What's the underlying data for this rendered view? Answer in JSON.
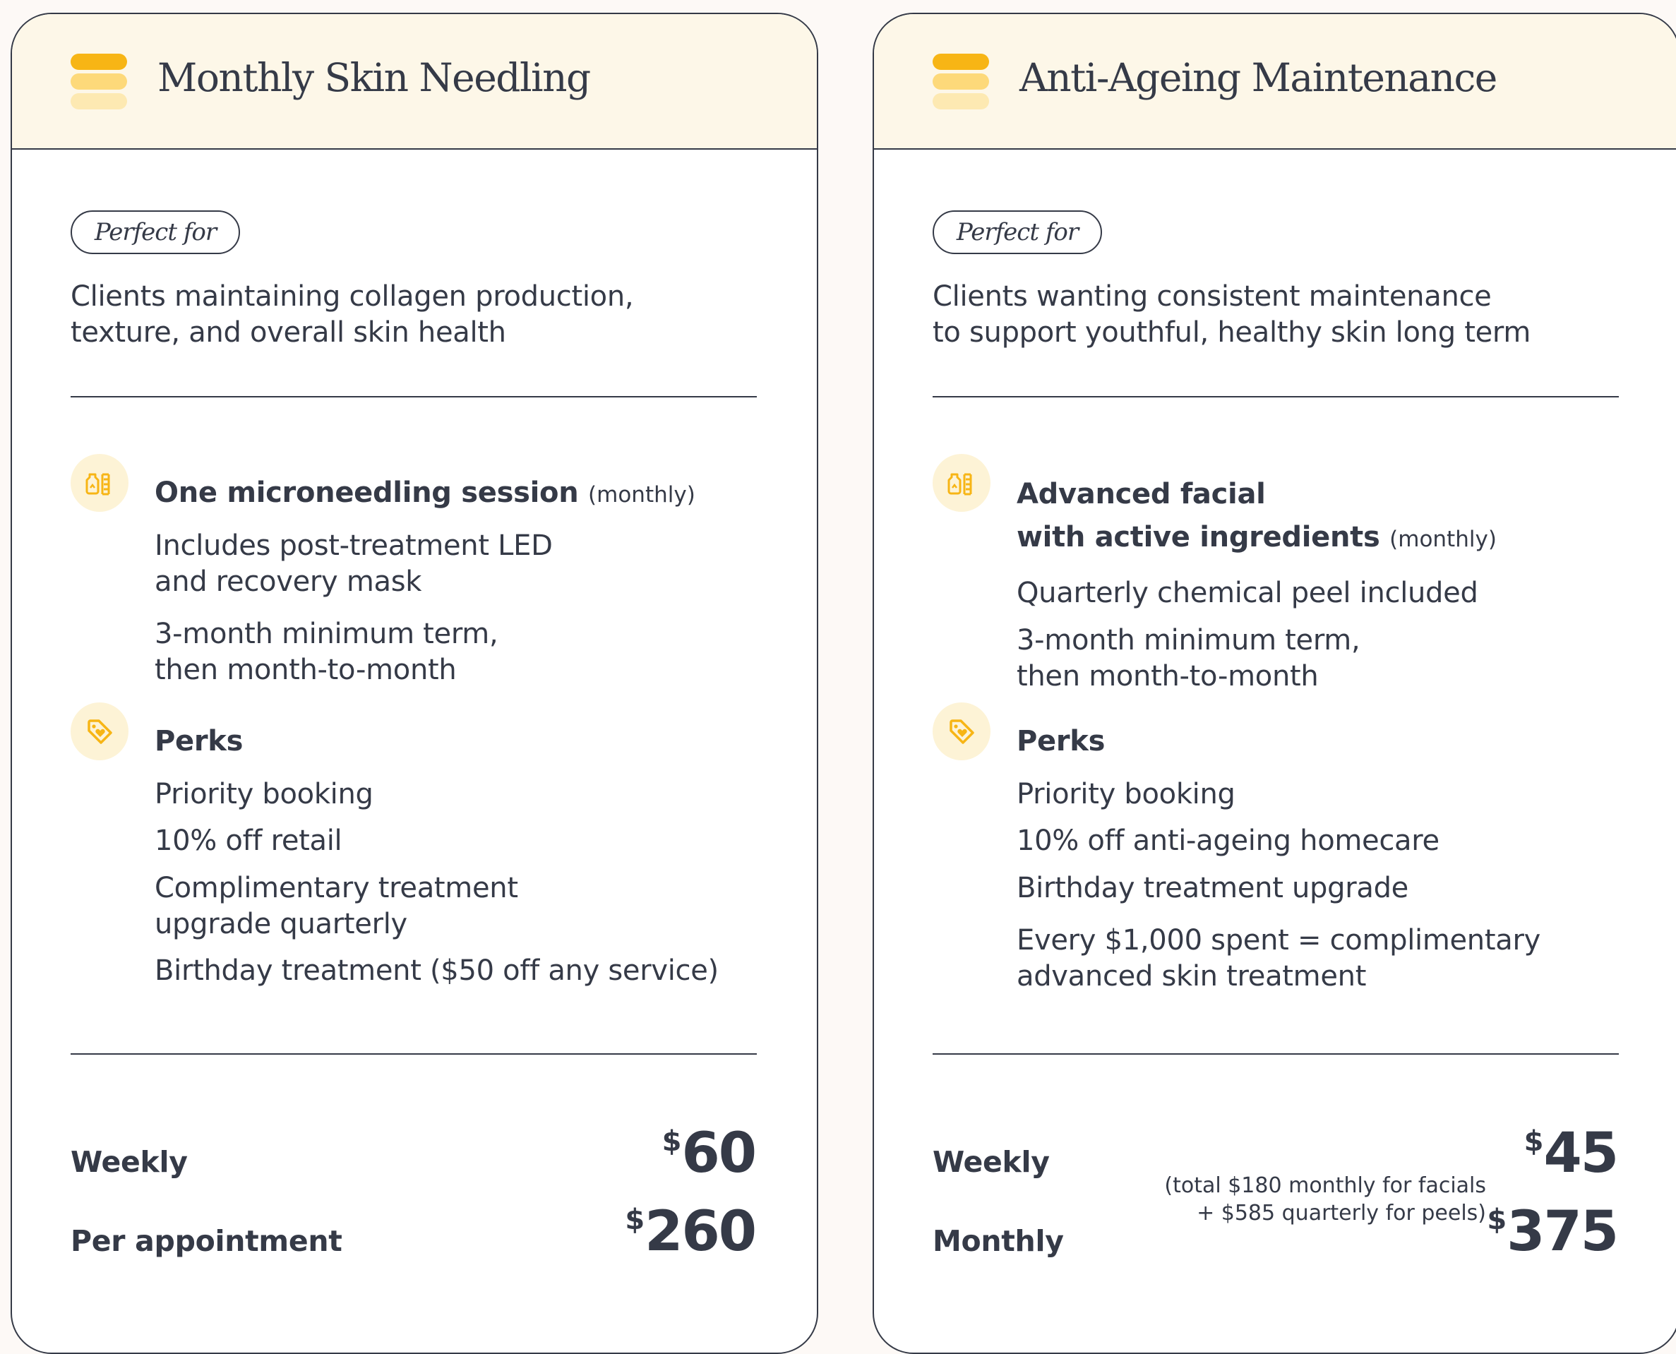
{
  "colors": {
    "accent": "#f7b515",
    "accent_light": "#fdd97a",
    "accent_pale": "#fde9b2",
    "header_bg": "#fdf7e8",
    "ink": "#353a47"
  },
  "cards": [
    {
      "title": "Monthly Skin Needling",
      "perfect_for_label": "Perfect for",
      "perfect_for_text": "Clients maintaining collagen production,\ntexture, and overall skin health",
      "service": {
        "icon": "serum-bottle-icon",
        "title": "One microneedling session",
        "title_suffix": "(monthly)",
        "lines": [
          "Includes post-treatment LED\nand recovery mask",
          "3-month minimum term,\nthen month-to-month"
        ]
      },
      "perks": {
        "icon": "heart-tag-icon",
        "title": "Perks",
        "items": [
          "Priority booking",
          "10% off retail",
          "Complimentary treatment\nupgrade quarterly",
          "Birthday treatment ($50 off any service)"
        ]
      },
      "pricing": [
        {
          "label": "Weekly",
          "currency": "$",
          "amount": "60"
        },
        {
          "label": "Per appointment",
          "currency": "$",
          "amount": "260"
        }
      ]
    },
    {
      "title": "Anti-Ageing Maintenance",
      "perfect_for_label": "Perfect for",
      "perfect_for_text": "Clients wanting consistent maintenance\nto support youthful, healthy skin long term",
      "service": {
        "icon": "serum-bottle-icon",
        "title_line1": "Advanced facial",
        "title_line2": "with active ingredients",
        "title_suffix": "(monthly)",
        "lines": [
          "Quarterly chemical peel included",
          "3-month minimum term,\nthen month-to-month"
        ]
      },
      "perks": {
        "icon": "heart-tag-icon",
        "title": "Perks",
        "items": [
          "Priority booking",
          "10% off anti-ageing homecare",
          "Birthday treatment upgrade",
          "Every $1,000 spent = complimentary\nadvanced skin treatment"
        ]
      },
      "pricing": [
        {
          "label": "Weekly",
          "currency": "$",
          "amount": "45"
        },
        {
          "label": "Monthly",
          "currency": "$",
          "amount": "375",
          "note": "(total $180 monthly for facials\n+ $585 quarterly for peels)"
        }
      ]
    }
  ]
}
